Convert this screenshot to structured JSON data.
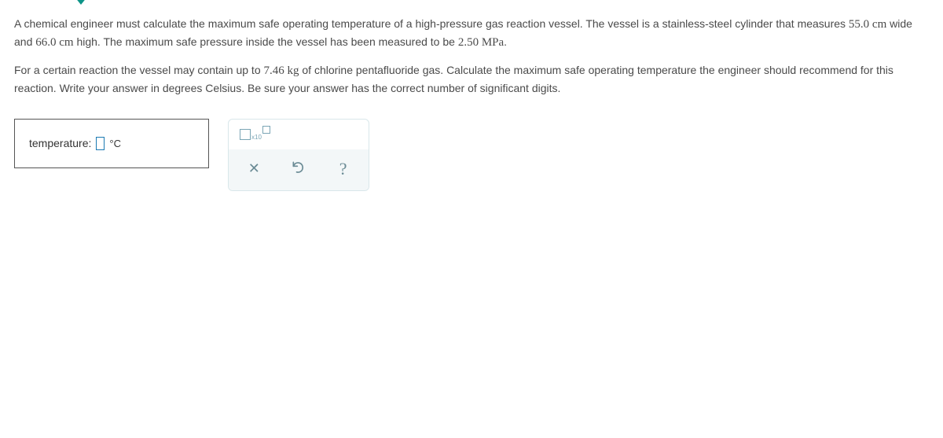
{
  "problem": {
    "p1_a": "A chemical engineer must calculate the maximum safe operating temperature of a high-pressure gas reaction vessel. The vessel is a stainless-steel cylinder that measures ",
    "p1_w": "55.0 cm",
    "p1_b": " wide and ",
    "p1_h": "66.0 cm",
    "p1_c": " high. The maximum safe pressure inside the vessel has been measured to be ",
    "p1_p": "2.50 MPa",
    "p1_d": ".",
    "p2_a": "For a certain reaction the vessel may contain up to ",
    "p2_m": "7.46 kg",
    "p2_b": " of chlorine pentafluoride gas. Calculate the maximum safe operating temperature the engineer should recommend for this reaction. Write your answer in degrees Celsius. Be sure your answer has the correct number of significant digits."
  },
  "answer": {
    "label": "temperature:",
    "unit": "°C",
    "value": ""
  },
  "tools": {
    "sci_x10": "x10",
    "clear": "✕",
    "help": "?"
  }
}
